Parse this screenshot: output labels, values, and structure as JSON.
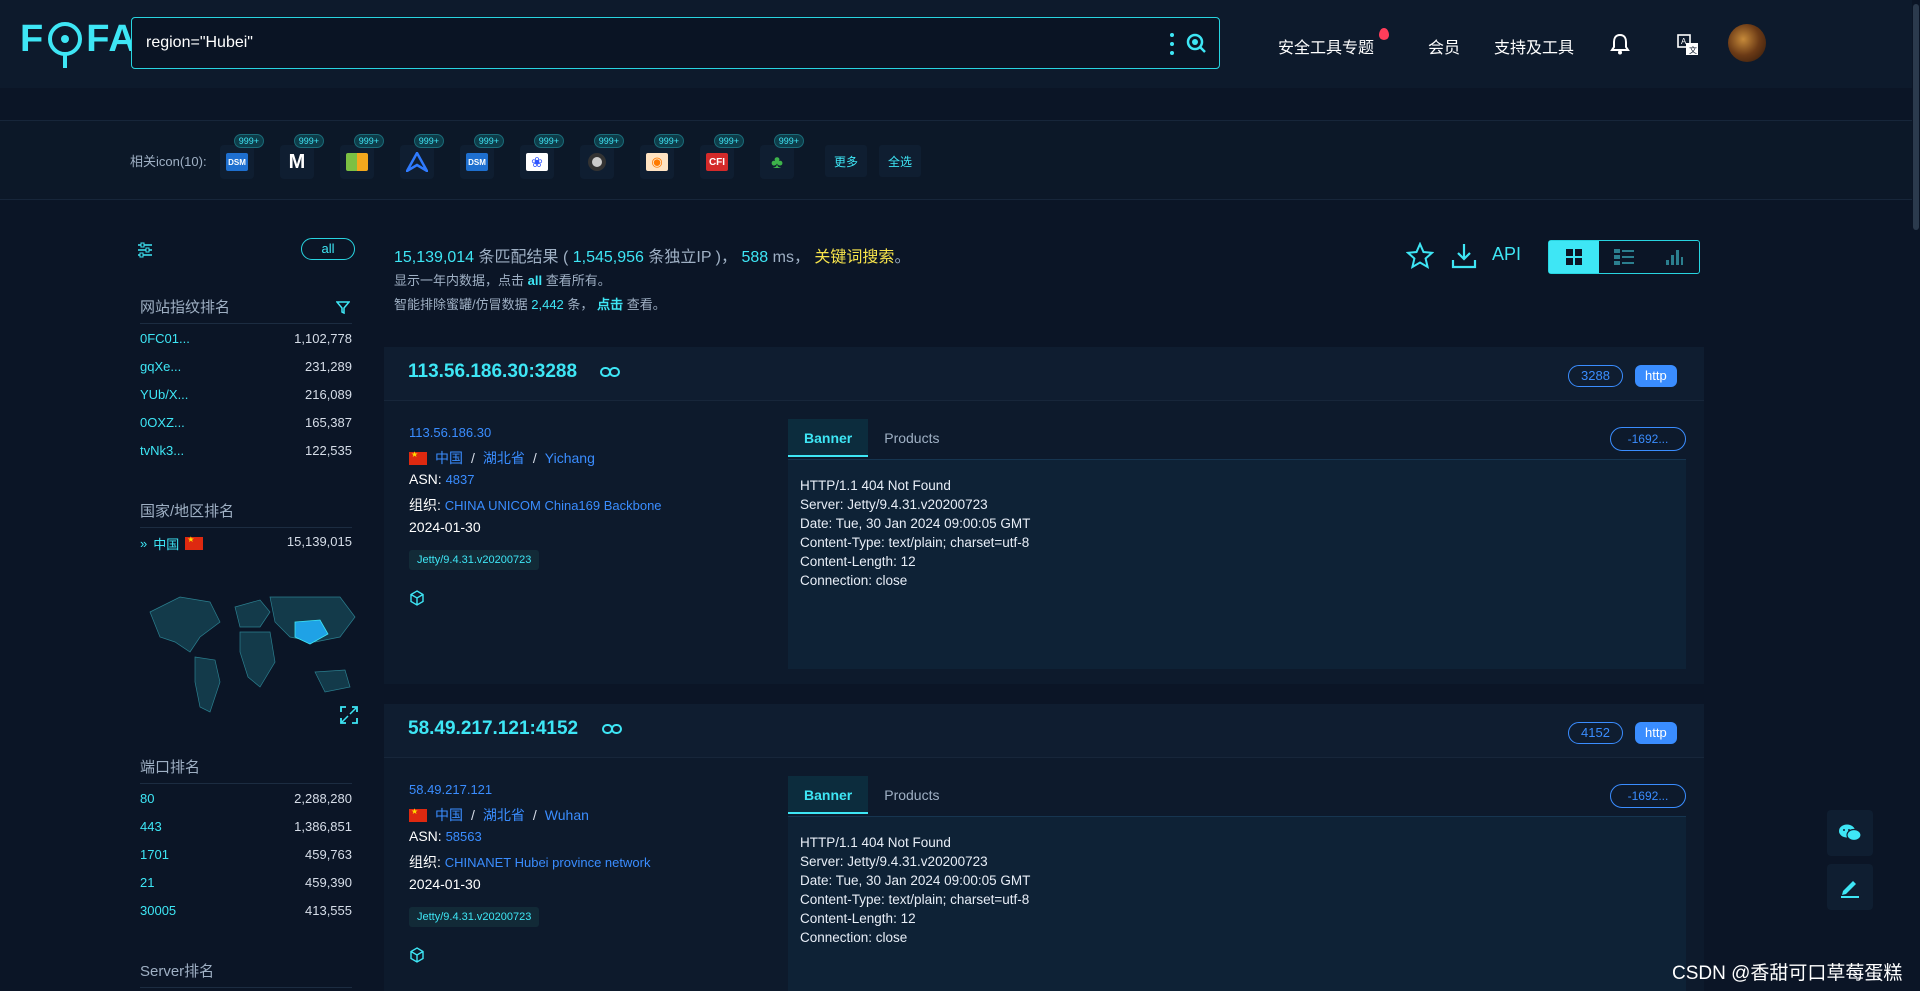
{
  "header": {
    "logo": "FOFA",
    "search_value": "region=\"Hubei\"",
    "nav": [
      "安全工具专题",
      "会员",
      "支持及工具"
    ]
  },
  "iconbar": {
    "label": "相关icon(10):",
    "items": [
      {
        "name": "DSM",
        "count": "999+",
        "color": "#1e6fcf"
      },
      {
        "name": "M",
        "count": "999+",
        "color": "#ffffff"
      },
      {
        "name": "grid-logo",
        "count": "999+",
        "color": "#7bc043"
      },
      {
        "name": "arrow-logo",
        "count": "999+",
        "color": "#2f7bff"
      },
      {
        "name": "DSM",
        "count": "999+",
        "color": "#1e6fcf"
      },
      {
        "name": "paw-logo",
        "count": "999+",
        "color": "#2f55ff"
      },
      {
        "name": "camera-logo",
        "count": "999+",
        "color": "#cccccc"
      },
      {
        "name": "eye-logo",
        "count": "999+",
        "color": "#ff7a00"
      },
      {
        "name": "CFI",
        "count": "999+",
        "color": "#d42a2a"
      },
      {
        "name": "tree-logo",
        "count": "999+",
        "color": "#3db34a"
      }
    ],
    "more_label": "更多",
    "select_all_label": "全选"
  },
  "sidebar": {
    "all_label": "all",
    "fingerprint_title": "网站指纹排名",
    "fingerprint_rows": [
      {
        "k": "0FC01...",
        "v": "1,102,778"
      },
      {
        "k": "gqXe...",
        "v": "231,289"
      },
      {
        "k": "YUb/X...",
        "v": "216,089"
      },
      {
        "k": "0OXZ...",
        "v": "165,387"
      },
      {
        "k": "tvNk3...",
        "v": "122,535"
      }
    ],
    "country_title": "国家/地区排名",
    "country_row": {
      "k": "中国",
      "v": "15,139,015"
    },
    "port_title": "端口排名",
    "port_rows": [
      {
        "k": "80",
        "v": "2,288,280"
      },
      {
        "k": "443",
        "v": "1,386,851"
      },
      {
        "k": "1701",
        "v": "459,763"
      },
      {
        "k": "21",
        "v": "459,390"
      },
      {
        "k": "30005",
        "v": "413,555"
      }
    ],
    "server_title": "Server排名"
  },
  "summary": {
    "total": "15,139,014",
    "text1": "条匹配结果 (",
    "unique_ip": "1,545,956",
    "text2": "条独立IP )，",
    "ms": "588",
    "text3": "ms，",
    "keyword_link": "关键词搜索",
    "text4": "。",
    "line2_a": "显示一年内数据，点击",
    "line2_all": "all",
    "line2_b": "查看所有。",
    "line3_a": "智能排除蜜罐/仿冒数据",
    "line3_count": "2,442",
    "line3_b": "条，",
    "line3_click": "点击",
    "line3_c": "查看。",
    "api_label": "API"
  },
  "results": [
    {
      "host": "113.56.186.30:3288",
      "port": "3288",
      "protocol": "http",
      "ip": "113.56.186.30",
      "country": "中国",
      "province": "湖北省",
      "city": "Yichang",
      "asn_label": "ASN:",
      "asn": "4837",
      "org_label": "组织:",
      "org": "CHINA UNICOM China169 Backbone",
      "date": "2024-01-30",
      "tag": "Jetty/9.4.31.v20200723",
      "tab_banner": "Banner",
      "tab_products": "Products",
      "hash": "-1692...",
      "banner": [
        "HTTP/1.1 404 Not Found",
        "Server: Jetty/9.4.31.v20200723",
        "Date: Tue, 30 Jan 2024 09:00:05 GMT",
        "Content-Type: text/plain; charset=utf-8",
        "Content-Length: 12",
        "Connection: close"
      ]
    },
    {
      "host": "58.49.217.121:4152",
      "port": "4152",
      "protocol": "http",
      "ip": "58.49.217.121",
      "country": "中国",
      "province": "湖北省",
      "city": "Wuhan",
      "asn_label": "ASN:",
      "asn": "58563",
      "org_label": "组织:",
      "org": "CHINANET Hubei province network",
      "date": "2024-01-30",
      "tag": "Jetty/9.4.31.v20200723",
      "tab_banner": "Banner",
      "tab_products": "Products",
      "hash": "-1692...",
      "banner": [
        "HTTP/1.1 404 Not Found",
        "Server: Jetty/9.4.31.v20200723",
        "Date: Tue, 30 Jan 2024 09:00:05 GMT",
        "Content-Type: text/plain; charset=utf-8",
        "Content-Length: 12",
        "Connection: close"
      ]
    }
  ],
  "watermark": "CSDN @香甜可口草莓蛋糕"
}
